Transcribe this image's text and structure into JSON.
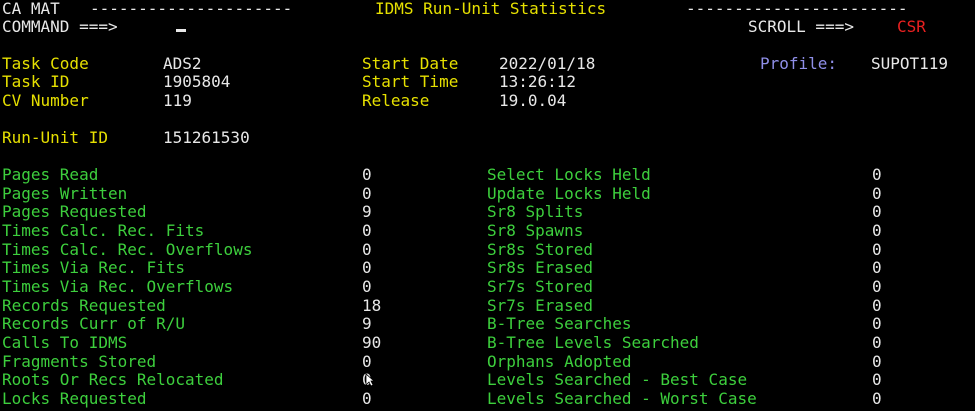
{
  "header": {
    "app": "CA MAT",
    "title": "IDMS Run-Unit Statistics",
    "dashes_left": "---------------------",
    "dashes_right": "-----------------------",
    "command_label": "COMMAND ===>",
    "scroll_label": "SCROLL ===>",
    "scroll_value": "CSR"
  },
  "info": {
    "task_code_label": "Task Code",
    "task_code": "ADS2",
    "task_id_label": "Task ID",
    "task_id": "1905804",
    "cv_label": "CV Number",
    "cv": "119",
    "start_date_label": "Start Date",
    "start_date": "2022/01/18",
    "start_time_label": "Start Time",
    "start_time": "13:26:12",
    "release_label": "Release",
    "release": "19.0.04",
    "profile_label": "Profile:",
    "profile": "SUPOT119",
    "run_unit_label": "Run-Unit ID",
    "run_unit": "151261530"
  },
  "stats_left": [
    {
      "label": "Pages Read",
      "value": "0"
    },
    {
      "label": "Pages Written",
      "value": "0"
    },
    {
      "label": "Pages Requested",
      "value": "9"
    },
    {
      "label": "Times Calc. Rec. Fits",
      "value": "0"
    },
    {
      "label": "Times Calc. Rec. Overflows",
      "value": "0"
    },
    {
      "label": "Times Via Rec. Fits",
      "value": "0"
    },
    {
      "label": "Times Via Rec. Overflows",
      "value": "0"
    },
    {
      "label": "Records Requested",
      "value": "18"
    },
    {
      "label": "Records Curr of R/U",
      "value": "9"
    },
    {
      "label": "Calls To IDMS",
      "value": "90"
    },
    {
      "label": "Fragments Stored",
      "value": "0"
    },
    {
      "label": "Roots Or Recs Relocated",
      "value": "0"
    },
    {
      "label": "Locks Requested",
      "value": "0"
    }
  ],
  "stats_right": [
    {
      "label": "Select Locks Held",
      "value": "0"
    },
    {
      "label": "Update Locks Held",
      "value": "0"
    },
    {
      "label": "Sr8 Splits",
      "value": "0"
    },
    {
      "label": "Sr8 Spawns",
      "value": "0"
    },
    {
      "label": "Sr8s Stored",
      "value": "0"
    },
    {
      "label": "Sr8s Erased",
      "value": "0"
    },
    {
      "label": "Sr7s Stored",
      "value": "0"
    },
    {
      "label": "Sr7s Erased",
      "value": "0"
    },
    {
      "label": "B-Tree Searches",
      "value": "0"
    },
    {
      "label": "B-Tree Levels Searched",
      "value": "0"
    },
    {
      "label": "Orphans Adopted",
      "value": "0"
    },
    {
      "label": "Levels Searched - Best Case",
      "value": "0"
    },
    {
      "label": "Levels Searched - Worst Case",
      "value": "0"
    }
  ],
  "colors": {
    "text": "#e8e8e8",
    "label": "#e6e000",
    "stat": "#3dcf3d",
    "profile": "#8f8fe8",
    "scroll_value": "#e82020"
  },
  "icons": {
    "pointer": "mouse-pointer-icon"
  }
}
